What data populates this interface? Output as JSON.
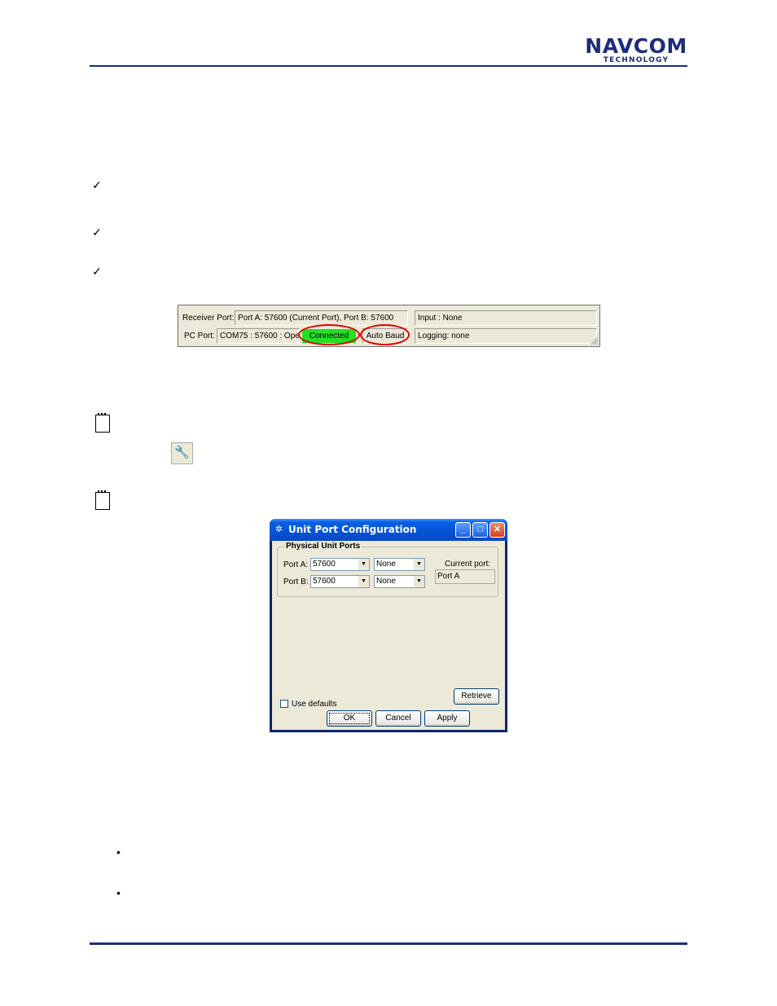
{
  "header": {
    "logo_line1": "NAVCOM",
    "logo_line2": "TECHNOLOGY"
  },
  "status_bar": {
    "receiver_port_label": "Receiver Port:",
    "receiver_port_value": "Port A: 57600 (Current Port), Port B: 57600",
    "input_value": "Input : None",
    "pc_port_label": "PC Port:",
    "pc_port_value": "COM75 : 57600 : Open",
    "connected": "Connected",
    "auto_baud": "Auto Baud",
    "logging_value": "Logging: none",
    "connected_color": "#22e022",
    "highlight_color": "#e00000"
  },
  "tool_icon": "wrench-icon",
  "dialog": {
    "title": "Unit Port Configuration",
    "group_title": "Physical  Unit Ports",
    "port_a_label": "Port A:",
    "port_a_baud": "57600",
    "port_a_mode": "None",
    "port_b_label": "Port B:",
    "port_b_baud": "57600",
    "port_b_mode": "None",
    "current_port_label": "Current port:",
    "current_port_value": "Port A",
    "use_defaults": "Use defaults",
    "retrieve": "Retrieve",
    "ok": "OK",
    "cancel": "Cancel",
    "apply": "Apply",
    "titlebar_color": "#0353d6"
  },
  "bullets": [
    "•",
    "•"
  ],
  "checks": [
    "✓",
    "✓",
    "✓"
  ]
}
